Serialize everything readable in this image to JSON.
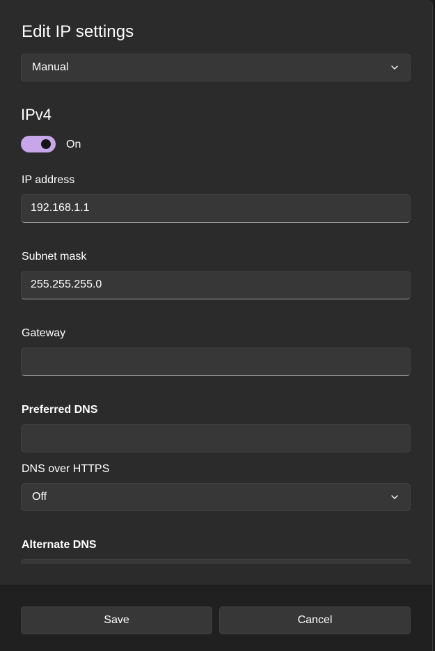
{
  "dialog": {
    "title": "Edit IP settings",
    "mode_dropdown": {
      "selected": "Manual"
    }
  },
  "ipv4": {
    "heading": "IPv4",
    "toggle": {
      "state_label": "On",
      "on": true,
      "accent_color": "#c7a6ea"
    },
    "fields": {
      "ip_address": {
        "label": "IP address",
        "value": "192.168.1.1"
      },
      "subnet_mask": {
        "label": "Subnet mask",
        "value": "255.255.255.0"
      },
      "gateway": {
        "label": "Gateway",
        "value": ""
      },
      "preferred_dns": {
        "label": "Preferred DNS",
        "value": ""
      },
      "dns_over_https": {
        "label": "DNS over HTTPS",
        "selected": "Off"
      },
      "alternate_dns": {
        "label": "Alternate DNS",
        "value": ""
      }
    }
  },
  "footer": {
    "save_label": "Save",
    "cancel_label": "Cancel"
  },
  "icons": {
    "dropdown": "chevron-down-icon"
  }
}
